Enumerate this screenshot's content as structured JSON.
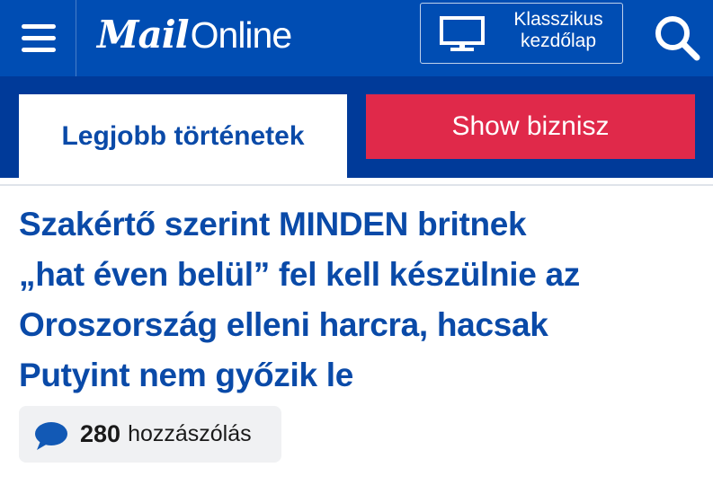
{
  "header": {
    "logo_main": "Mail",
    "logo_sub": "Online",
    "classic_line1": "Klasszikus",
    "classic_line2": "kezdőlap",
    "icons": [
      "hamburger-menu-icon",
      "monitor-icon",
      "search-icon"
    ]
  },
  "tabs": [
    {
      "label": "Legjobb történetek",
      "active": true
    },
    {
      "label": "Show biznisz",
      "active": false
    }
  ],
  "article": {
    "headline_line1": "Szakértő szerint MINDEN britnek",
    "headline_line2": "„hat éven belül” fel kell készülnie az",
    "headline_line3": "Oroszország elleni harcra, hacsak",
    "headline_line4": "Putyint nem győzik le",
    "comment_count": "280",
    "comment_label": "hozzászólás"
  },
  "colors": {
    "brand_blue": "#004db3",
    "subnav_blue": "#003a99",
    "headline_blue": "#0a4aa8",
    "show_red": "#e0294a"
  }
}
